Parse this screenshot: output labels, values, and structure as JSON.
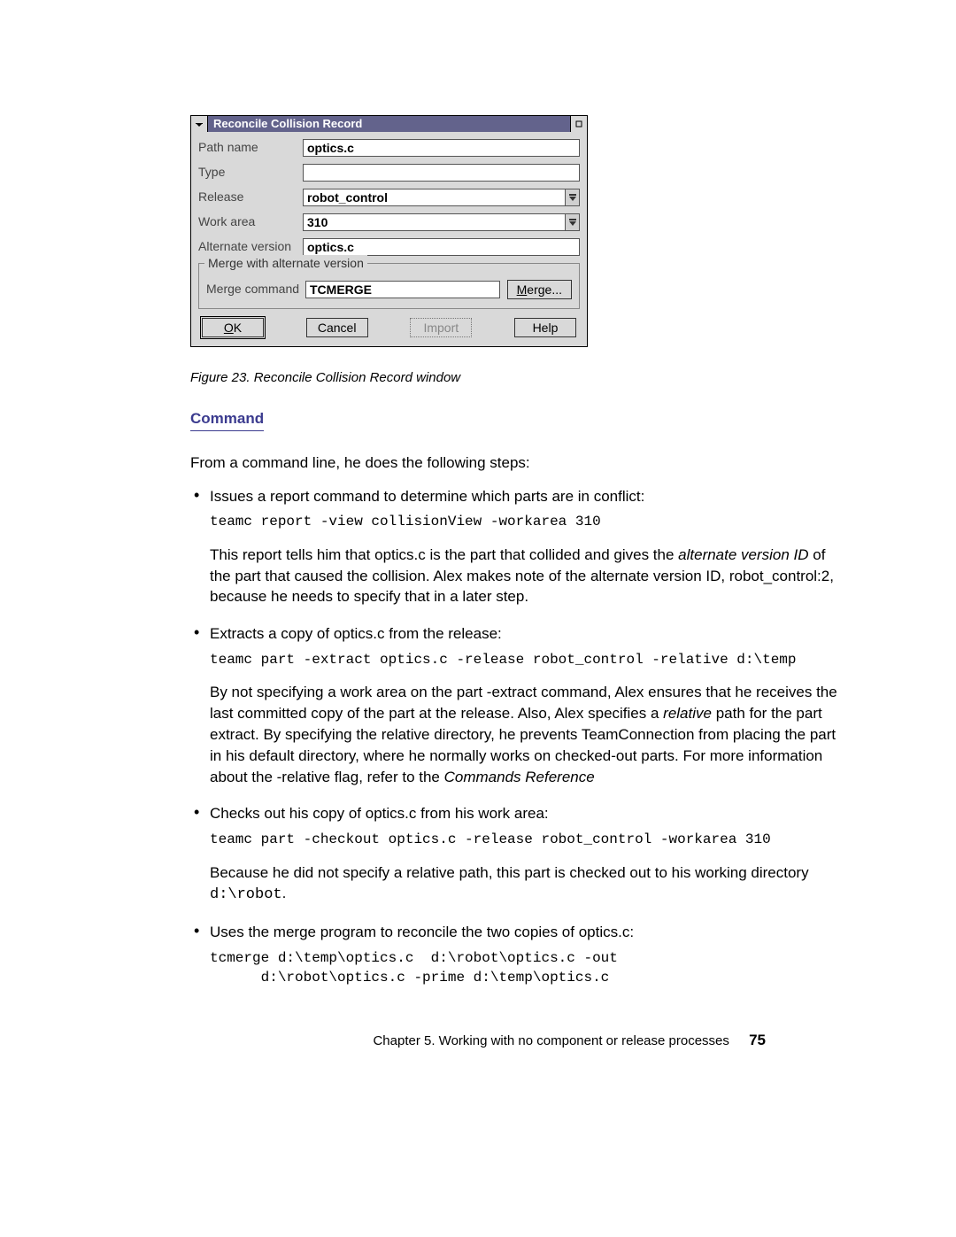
{
  "dialog": {
    "title": "Reconcile Collision Record",
    "rows": {
      "path_name_label": "Path name",
      "path_name_value": "optics.c",
      "type_label": "Type",
      "type_value": "",
      "release_label": "Release",
      "release_value": "robot_control",
      "workarea_label": "Work area",
      "workarea_value": "310",
      "altver_label": "Alternate version",
      "altver_value": "optics.c"
    },
    "group": {
      "legend": "Merge with alternate version",
      "merge_cmd_label": "Merge command",
      "merge_cmd_value": "TCMERGE",
      "merge_btn_plain": "erge...",
      "merge_btn_ul": "M"
    },
    "buttons": {
      "ok_ul": "O",
      "ok_plain": "K",
      "cancel": "Cancel",
      "import": "Import",
      "help": "Help"
    }
  },
  "figure_caption": "Figure 23. Reconcile Collision Record window",
  "section_heading": "Command",
  "intro_line": "From a command line, he does the following steps:",
  "bullets": {
    "b1_line": "Issues a report command to determine which parts are in conflict:",
    "b1_code": "teamc report -view collisionView -workarea 310",
    "b1_p_a": "This report tells him that optics.c is the part that collided and gives the ",
    "b1_p_ital": "alternate version ID",
    "b1_p_b": " of the part that caused the collision. Alex makes note of the alternate version ID, robot_control:2, because he needs to specify that in a later step.",
    "b2_line": "Extracts a copy of optics.c from the release:",
    "b2_code": "teamc part -extract optics.c -release robot_control -relative d:\\temp",
    "b2_p_a": "By not specifying a work area on the part -extract command, Alex ensures that he receives the last committed copy of the part at the release. Also, Alex specifies a ",
    "b2_p_ital1": "relative",
    "b2_p_b": " path for the part extract. By specifying the relative directory, he prevents TeamConnection from placing the part in his default directory, where he normally works on checked-out parts. For more information about the -relative flag, refer to the ",
    "b2_p_ital2": "Commands Reference",
    "b3_line": "Checks out his copy of optics.c from his work area:",
    "b3_code": "teamc part -checkout optics.c -release robot_control -workarea 310",
    "b3_p_a": "Because he did not specify a relative path, this part is checked out to his working directory ",
    "b3_p_code": "d:\\robot",
    "b3_p_b": ".",
    "b4_line": "Uses the merge program to reconcile the two copies of optics.c:",
    "b4_code": "tcmerge d:\\temp\\optics.c  d:\\robot\\optics.c -out\n      d:\\robot\\optics.c -prime d:\\temp\\optics.c"
  },
  "footer": {
    "chapter": "Chapter 5. Working with no component or release processes",
    "page": "75"
  }
}
